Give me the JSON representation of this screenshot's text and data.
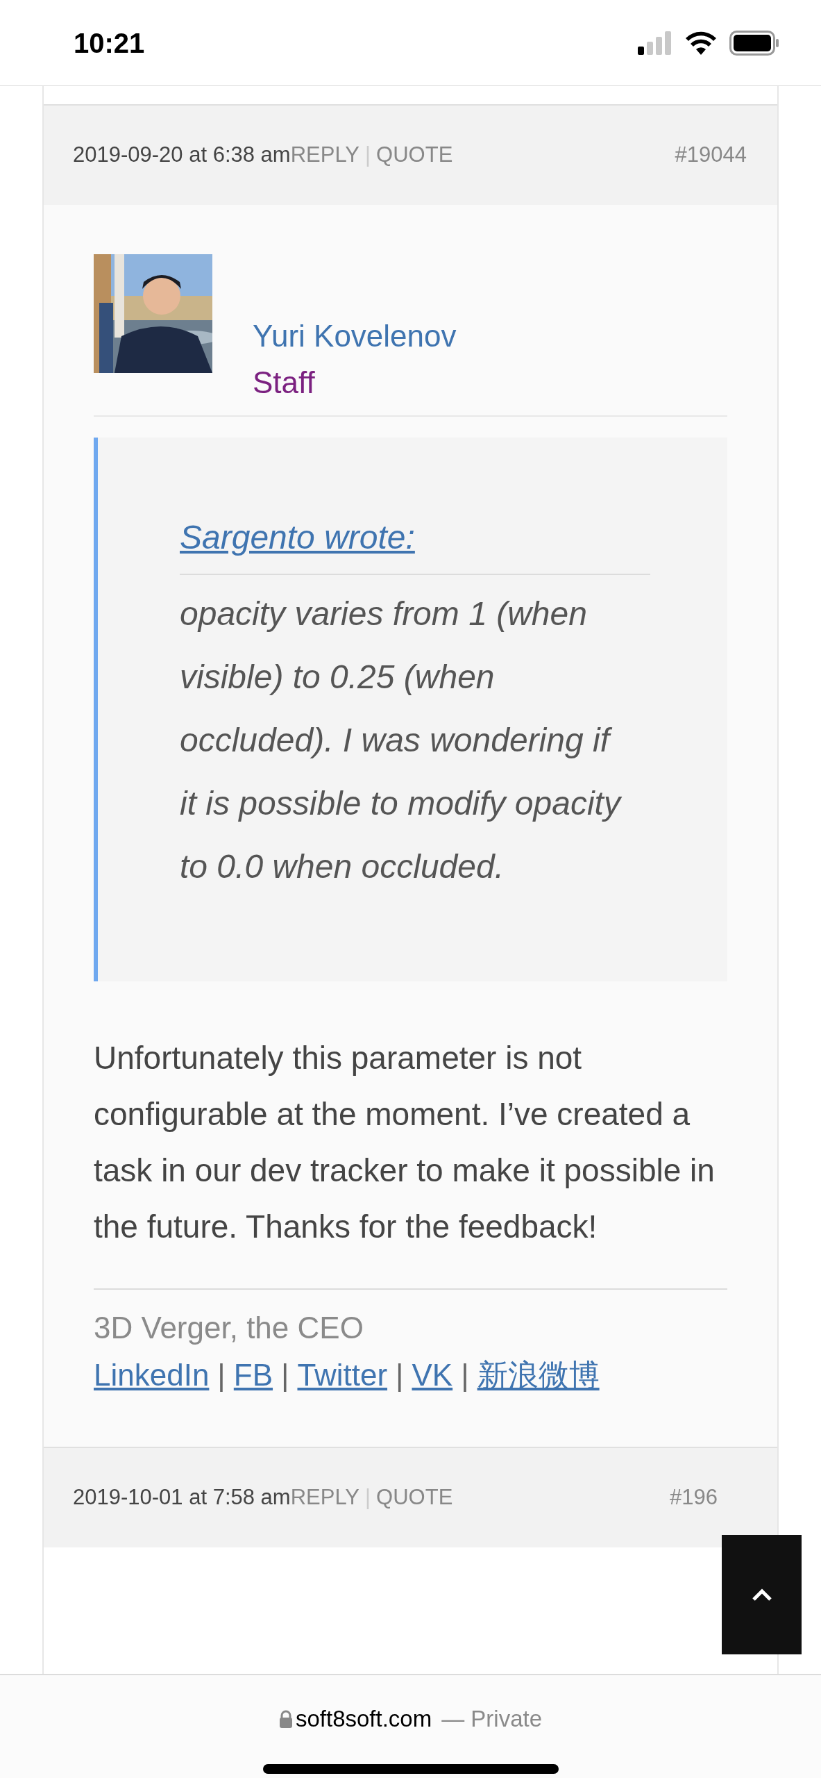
{
  "status_bar": {
    "time": "10:21"
  },
  "post_header": {
    "date": "2019-09-20 at 6:38 am",
    "reply": "REPLY",
    "separator": "|",
    "quote": "QUOTE",
    "number": "#19044"
  },
  "post": {
    "author": {
      "name": "Yuri Kovelenov",
      "role": "Staff"
    },
    "quote": {
      "source": "Sargento wrote:",
      "text": "opacity varies from 1 (when visible) to 0.25 (when occluded). I was wondering if it is possible to modify opacity to 0.0 when occluded."
    },
    "body": "Unfortunately this parameter is not configurable at the moment. I’ve created a task in our dev tracker to make it possible in the future. Thanks for the feedback!",
    "signature": {
      "title": "3D Verger, the CEO",
      "separator": "|",
      "links": [
        "LinkedIn",
        "FB",
        "Twitter",
        "VK",
        "新浪微博"
      ]
    }
  },
  "next_post_header": {
    "date": "2019-10-01 at 7:58 am",
    "reply": "REPLY",
    "separator": "|",
    "quote": "QUOTE",
    "number": "#196"
  },
  "browser_bar": {
    "domain": "soft8soft.com",
    "privacy": "— Private"
  }
}
